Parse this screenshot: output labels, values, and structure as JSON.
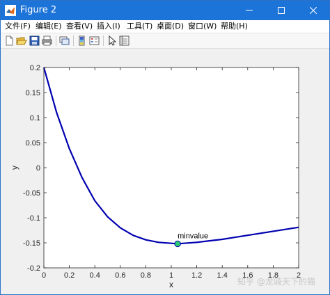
{
  "window": {
    "title": "Figure 2"
  },
  "menubar": {
    "items": [
      {
        "label": "文件(F)"
      },
      {
        "label": "编辑(E)"
      },
      {
        "label": "查看(V)"
      },
      {
        "label": "插入(I)"
      },
      {
        "label": "工具(T)"
      },
      {
        "label": "桌面(D)"
      },
      {
        "label": "窗口(W)"
      },
      {
        "label": "帮助(H)"
      }
    ]
  },
  "toolbar": {
    "icons": [
      "new-figure-icon",
      "open-file-icon",
      "save-icon",
      "print-icon",
      "link-plot-icon",
      "insert-colorbar-icon",
      "insert-legend-icon",
      "edit-plot-icon",
      "property-inspector-icon"
    ]
  },
  "watermark": "知乎 @龙骑天下的猫",
  "colors": {
    "line": "#0000b0",
    "marker_fill": "#2ecc71",
    "marker_edge": "#0000b0",
    "titlebar": "#1d74d8"
  },
  "chart_data": {
    "type": "line",
    "title": "",
    "xlabel": "x",
    "ylabel": "y",
    "xlim": [
      0,
      2
    ],
    "ylim": [
      -0.2,
      0.2
    ],
    "x_ticks": [
      "0",
      "0.2",
      "0.4",
      "0.6",
      "0.8",
      "1",
      "1.2",
      "1.4",
      "1.6",
      "1.8",
      "2"
    ],
    "y_ticks": [
      "0.2",
      "0.15",
      "0.1",
      "0.05",
      "0",
      "-0.05",
      "-0.1",
      "-0.15",
      "-0.2"
    ],
    "grid": false,
    "series": [
      {
        "x": [
          0,
          0.1,
          0.2,
          0.3,
          0.4,
          0.5,
          0.6,
          0.7,
          0.8,
          0.9,
          1.0,
          1.05,
          1.1,
          1.2,
          1.3,
          1.4,
          1.5,
          1.6,
          1.7,
          1.8,
          1.9,
          2.0
        ],
        "y": [
          0.2,
          0.11,
          0.038,
          -0.02,
          -0.066,
          -0.098,
          -0.12,
          -0.135,
          -0.144,
          -0.149,
          -0.151,
          -0.152,
          -0.151,
          -0.149,
          -0.146,
          -0.143,
          -0.139,
          -0.135,
          -0.131,
          -0.127,
          -0.123,
          -0.119
        ]
      }
    ],
    "annotations": [
      {
        "text": "minvalue",
        "x": 1.05,
        "y": -0.152
      }
    ]
  }
}
